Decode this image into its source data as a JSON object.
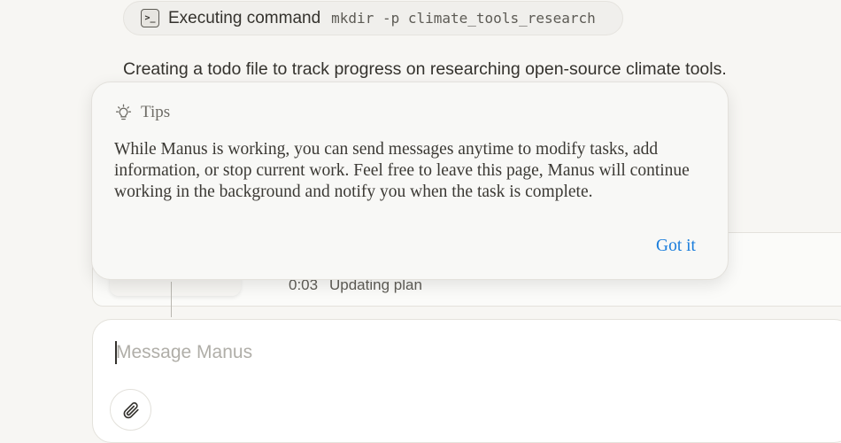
{
  "command": {
    "label": "Executing command",
    "code": "mkdir -p climate_tools_research",
    "icon": "terminal-icon"
  },
  "status_message": "Creating a todo file to track progress on researching open-source climate tools.",
  "progress": {
    "step_time": "0:03",
    "step_label": "Updating plan"
  },
  "tips": {
    "title": "Tips",
    "icon": "lightbulb-icon",
    "body": "While Manus is working, you can send messages anytime to modify tasks, add information, or stop current work. Feel free to leave this page, Manus will continue working in the background and notify you when the task is complete.",
    "action_label": "Got it",
    "action_color": "#1a7ddc"
  },
  "composer": {
    "placeholder": "Message Manus",
    "value": "",
    "attach_icon": "paperclip-icon"
  }
}
